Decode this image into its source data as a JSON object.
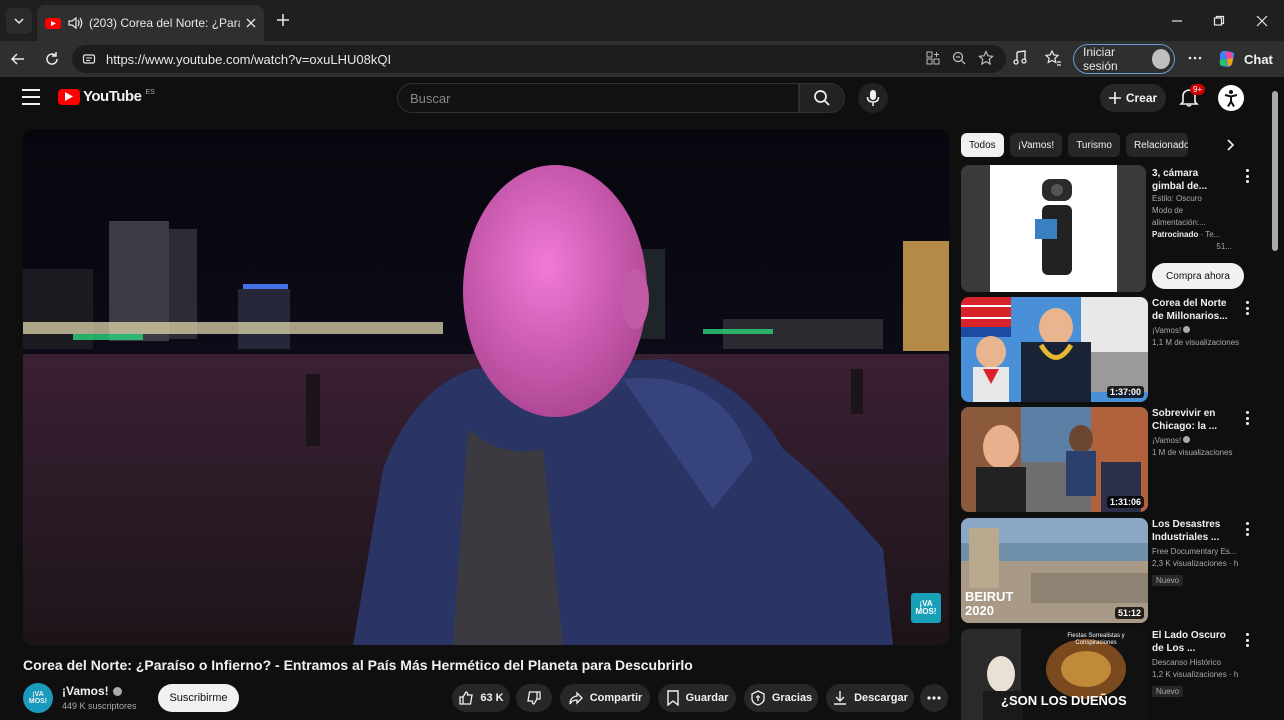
{
  "browser": {
    "tab_title": "(203) Corea del Norte: ¿Paraíso",
    "url": "https://www.youtube.com/watch?v=oxuLHU08kQI",
    "signin_label": "Iniciar sesión",
    "chat_label": "Chat"
  },
  "youtube": {
    "logo_text": "YouTube",
    "logo_region": "ES",
    "search_placeholder": "Buscar",
    "create_label": "Crear",
    "notifications_badge": "9+"
  },
  "video": {
    "title": "Corea del Norte: ¿Paraíso o Infierno? - Entramos al País Más Hermético del Planeta para Descubrirlo",
    "channel_name": "¡Vamos!",
    "channel_avatar_text": "¡VA MOS!",
    "subscribers": "449 K suscriptores",
    "subscribe_label": "Suscribirme",
    "likes": "63 K",
    "share_label": "Compartir",
    "save_label": "Guardar",
    "thanks_label": "Gracias",
    "download_label": "Descargar",
    "watermark": "¡VA MOS!"
  },
  "chips": [
    "Todos",
    "¡Vamos!",
    "Turismo",
    "Relacionado"
  ],
  "ad": {
    "title": "3, cámara\ngimbal de...",
    "meta1": "Estilo: Oscuro",
    "meta2": "Modo de",
    "meta3": "alimentación:...",
    "sponsored": "Patrocinado",
    "sponsored_extra": "· Te...",
    "meta4": "51...",
    "cta": "Compra ahora"
  },
  "recommendations": [
    {
      "title": "Corea del Norte\nde Millonarios...",
      "channel": "¡Vamos!",
      "views": "1,1 M de visualizaciones",
      "duration": "1:37:00",
      "thumb_text": ""
    },
    {
      "title": "Sobrevivir en\nChicago: la ...",
      "channel": "¡Vamos!",
      "views": "1 M de visualizaciones",
      "duration": "1:31:06",
      "thumb_text": ""
    },
    {
      "title": "Los Desastres\nIndustriales ...",
      "channel": "Free Documentary Es...",
      "views": "2,3 K visualizaciones · h",
      "duration": "51:12",
      "badge": "Nuevo",
      "thumb_text": "BEIRUT\n2020"
    },
    {
      "title": "El Lado Oscuro\nde Los ...",
      "channel": "Descanso Histórico",
      "views": "1,2 K visualizaciones · h",
      "duration": "",
      "badge": "Nuevo",
      "thumb_text": "¿SON LOS DUEÑOS",
      "thumb_top_text": "Fiestas Surrealistas y Conspiraciones"
    }
  ],
  "colors": {
    "brand_red": "#ff0000",
    "bg": "#0f0f0f",
    "surface": "#272727"
  }
}
